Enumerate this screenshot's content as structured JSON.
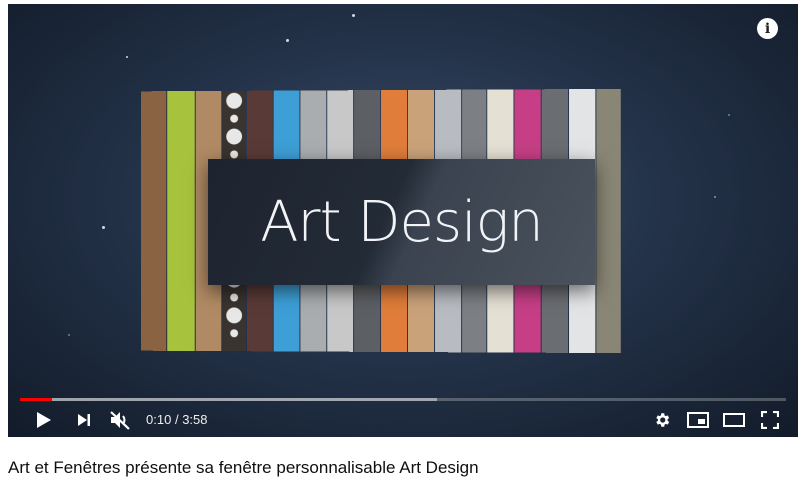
{
  "video": {
    "title_card_text": "Art Design",
    "progress_fraction": 0.042,
    "buffer_fraction": 0.545,
    "swatch_colors": [
      "#8a6442",
      "#a7c23c",
      "#b08a64",
      "#e6e6e6",
      "#5a3a36",
      "#3d9fd6",
      "#a9adb0",
      "#c8c8c8",
      "#5c5f64",
      "#e07d3a",
      "#caa27a",
      "#b8bcc0",
      "#7c7f84",
      "#e4e0d4",
      "#c63f86",
      "#6a6d72",
      "#e2e4e6",
      "#8a8676"
    ]
  },
  "controls": {
    "current_time": "0:10",
    "separator": "/",
    "duration": "3:58",
    "icons": [
      "play-icon",
      "next-icon",
      "mute-icon",
      "gear-icon",
      "miniplayer-icon",
      "theater-icon",
      "fullscreen-icon",
      "info-icon"
    ]
  },
  "caption": {
    "title": "Art et Fenêtres présente sa fenêtre personnalisable Art Design"
  }
}
